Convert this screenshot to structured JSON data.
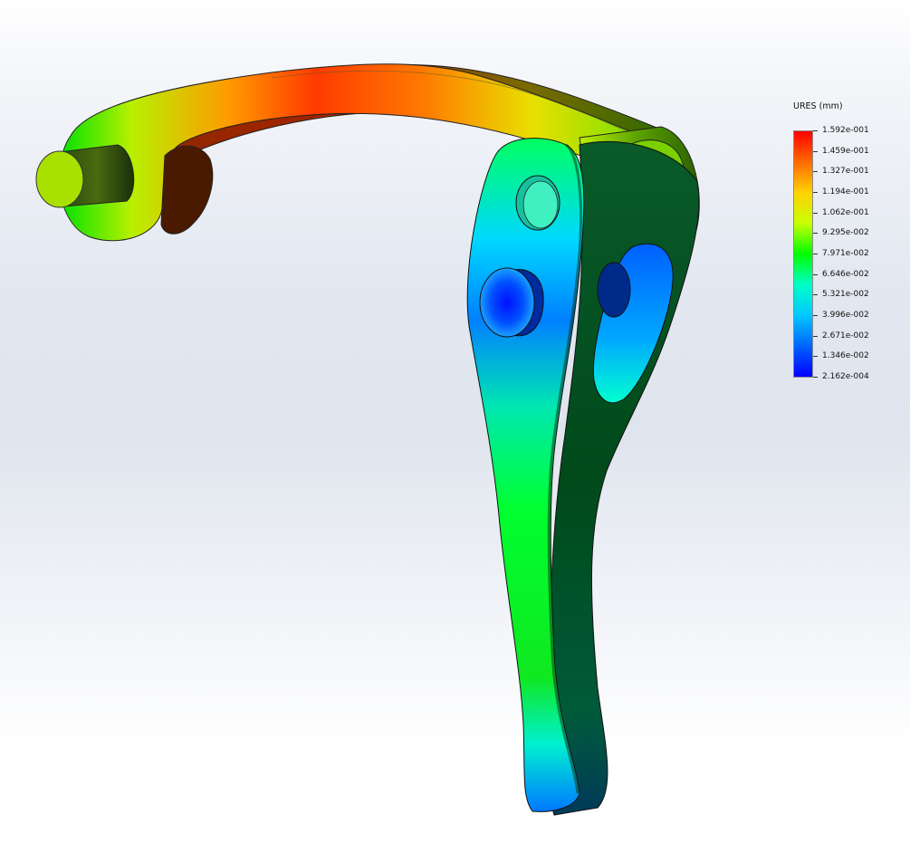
{
  "legend": {
    "title": "URES (mm)",
    "labels": [
      "1.592e-001",
      "1.459e-001",
      "1.327e-001",
      "1.194e-001",
      "1.062e-001",
      "9.295e-002",
      "7.971e-002",
      "6.646e-002",
      "5.321e-002",
      "3.996e-002",
      "2.671e-002",
      "1.346e-002",
      "2.162e-004"
    ],
    "colors": [
      "#ff0000",
      "#ff6a00",
      "#ffd200",
      "#c8ff00",
      "#00ff00",
      "#00ffc8",
      "#00c8ff",
      "#0064ff",
      "#0000ff"
    ]
  }
}
